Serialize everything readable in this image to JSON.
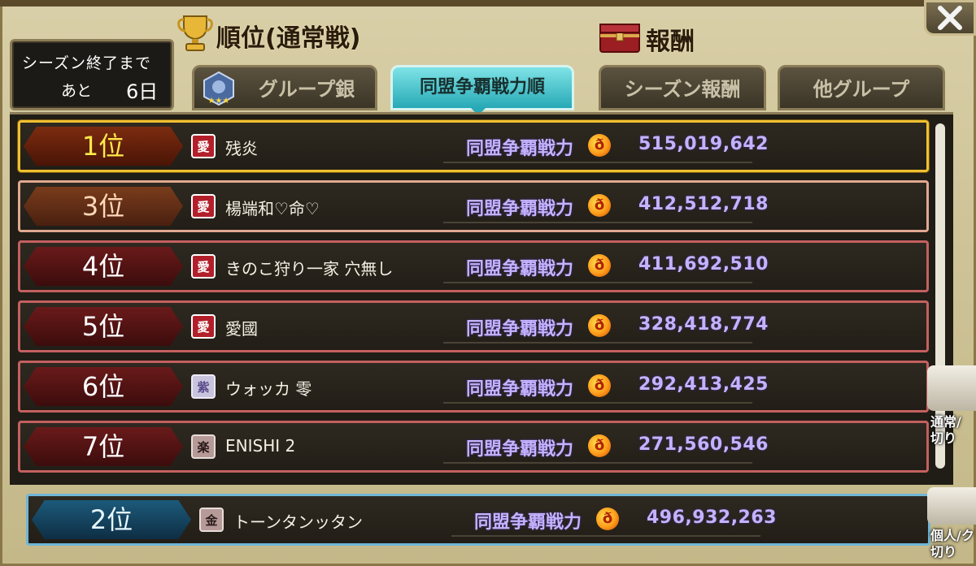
{
  "season": {
    "line1": "シーズン終了まで",
    "line2": "あと",
    "days": "6日"
  },
  "ranking_title": "順位(通常戦)",
  "reward_title": "報酬",
  "tabs": [
    {
      "label": "グループ銀",
      "active": false
    },
    {
      "label": "同盟争覇戦力順",
      "active": true
    },
    {
      "label": "シーズン報酬",
      "active": false
    },
    {
      "label": "他グループ",
      "active": false
    }
  ],
  "rows": [
    {
      "rank": "1位",
      "flag": "愛",
      "name": "残炎",
      "power_label": "同盟争覇戦力",
      "power": "515,019,642",
      "style": "gold"
    },
    {
      "rank": "3位",
      "flag": "愛",
      "name": "楊端和♡命♡",
      "power_label": "同盟争覇戦力",
      "power": "412,512,718",
      "style": "bronze"
    },
    {
      "rank": "4位",
      "flag": "愛",
      "name": "きのこ狩り一家 穴無し",
      "power_label": "同盟争覇戦力",
      "power": "411,692,510",
      "style": "red"
    },
    {
      "rank": "5位",
      "flag": "愛",
      "name": "愛國",
      "power_label": "同盟争覇戦力",
      "power": "328,418,774",
      "style": "red"
    },
    {
      "rank": "6位",
      "flag": "紫",
      "name": "ウォッカ 零",
      "power_label": "同盟争覇戦力",
      "power": "292,413,425",
      "style": "red"
    },
    {
      "rank": "7位",
      "flag": "楽",
      "name": "ENISHI 2",
      "power_label": "同盟争覇戦力",
      "power": "271,560,546",
      "style": "red"
    }
  ],
  "my_row": {
    "rank": "2位",
    "flag": "金",
    "name": "トーンタンッタン",
    "power_label": "同盟争覇戦力",
    "power": "496,932,263"
  },
  "side": {
    "widget1_line1": "通常/",
    "widget1_line2": "切り",
    "widget2_line1": "個人/ク",
    "widget2_line2": "切り"
  },
  "colors": {
    "power_text": "#c4b2ff",
    "active_tab": "#27a9b6",
    "gold_border": "#f0c030"
  }
}
